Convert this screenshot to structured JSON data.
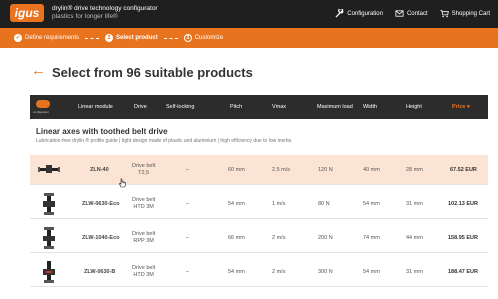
{
  "header": {
    "logo": "igus",
    "brand_title": "drylin® drive technology configurator",
    "brand_sub": "plastics for longer life®",
    "nav": [
      {
        "label": "Configuration",
        "icon": "wrench-icon"
      },
      {
        "label": "Contact",
        "icon": "mail-icon"
      },
      {
        "label": "Shopping Cart",
        "icon": "cart-icon"
      }
    ]
  },
  "steps": [
    {
      "num": "✓",
      "label": "Define requirements",
      "state": "done"
    },
    {
      "num": "2",
      "label": "Select product",
      "state": "current"
    },
    {
      "num": "3",
      "label": "Customize",
      "state": "pending"
    }
  ],
  "page": {
    "title": "Select from 96 suitable products"
  },
  "table": {
    "header_icon_caption": "configurator",
    "columns": {
      "linear_module": "Linear module",
      "drive": "Drive",
      "self_locking": "Self-locking",
      "pitch": "Pitch",
      "vmax": "Vmax",
      "max_load": "Maximum load",
      "width": "Width",
      "height": "Height",
      "price": "Price ▾"
    },
    "section_title": "Linear axes with toothed belt drive",
    "section_sub": "Lubrication-free drylin ® profile guide | tight design made of plastic and aluminium | high efficiency due to low inertia",
    "rows": [
      {
        "model": "ZLN-40",
        "drive1": "Drive belt",
        "drive2": "T2,5",
        "self_locking": "–",
        "pitch": "60 mm",
        "vmax": "2.5 m/s",
        "load": "120 N",
        "width": "40 mm",
        "height": "28 mm",
        "price": "67.52 EUR"
      },
      {
        "model": "ZLW-0630-Eco",
        "drive1": "Drive belt",
        "drive2": "HTD 3M",
        "self_locking": "–",
        "pitch": "54 mm",
        "vmax": "1 m/s",
        "load": "80 N",
        "width": "54 mm",
        "height": "31 mm",
        "price": "102.13 EUR"
      },
      {
        "model": "ZLW-1040-Eco",
        "drive1": "Drive belt",
        "drive2": "RPP 3M",
        "self_locking": "–",
        "pitch": "66 mm",
        "vmax": "2 m/s",
        "load": "200 N",
        "width": "74 mm",
        "height": "44 mm",
        "price": "158.95 EUR"
      },
      {
        "model": "ZLW-0630-B",
        "drive1": "Drive belt",
        "drive2": "HTD 3M",
        "self_locking": "–",
        "pitch": "54 mm",
        "vmax": "2 m/s",
        "load": "300 N",
        "width": "54 mm",
        "height": "31 mm",
        "price": "188.47 EUR"
      }
    ]
  },
  "colors": {
    "accent": "#e8731f",
    "header_bg": "#1f1f1f",
    "table_header_bg": "#2c2c2c",
    "highlight_row": "#fbe4d4"
  }
}
